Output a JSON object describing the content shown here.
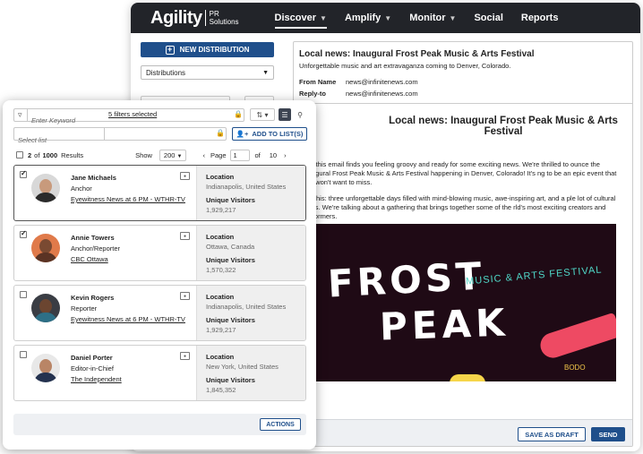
{
  "app": {
    "logo": "Agility",
    "logo_sub_line1": "PR",
    "logo_sub_line2": "Solutions"
  },
  "nav": [
    {
      "label": "Discover",
      "active": true,
      "dropdown": true
    },
    {
      "label": "Amplify",
      "active": false,
      "dropdown": true
    },
    {
      "label": "Monitor",
      "active": false,
      "dropdown": true
    },
    {
      "label": "Social",
      "active": false,
      "dropdown": false
    },
    {
      "label": "Reports",
      "active": false,
      "dropdown": false
    }
  ],
  "left": {
    "new_distribution": "NEW DISTRIBUTION",
    "distributions_select": "Distributions"
  },
  "email": {
    "subject": "Local news: Inaugural Frost Peak Music & Arts Festival",
    "preview": "Unforgettable music and art extravaganza coming to Denver, Colorado.",
    "from_label": "From Name",
    "from_value": "news@infinitenews.com",
    "reply_label": "Reply-to",
    "reply_value": "news@infinitenews.com",
    "title": "Local news: Inaugural Frost Peak Music & Arts Festival",
    "greeting": "llo,",
    "para1": "ope this email finds you feeling groovy and ready for some exciting news. We're thrilled to ounce the inaugural Frost Peak Music & Arts Festival happening in Denver, Colorado! It's ng to be an epic event that you won't want to miss.",
    "para2": "ure this: three unforgettable days filled with mind-blowing music, awe-inspiring art, and a ple lot of cultural vibes. We're talking about a gathering that brings together some of the rld's most exciting creators and performers.",
    "poster_frost": "FROST",
    "poster_peak": "PEAK",
    "poster_tagline": "MUSIC & ARTS FESTIVAL",
    "poster_small": "BODO",
    "save_draft": "SAVE AS DRAFT",
    "send": "SEND"
  },
  "list_panel": {
    "keyword_placeholder": "Enter Keyword",
    "filters_link": "5 filters selected",
    "select_list_placeholder": "Select list",
    "add_to_list": "ADD TO LIST(S)",
    "selected_count": "2",
    "of_label": "of",
    "total": "1000",
    "results_label": "Results",
    "show_label": "Show",
    "show_value": "200",
    "page_label": "Page",
    "page_value": "1",
    "page_of": "of",
    "page_total": "10",
    "actions": "ACTIONS"
  },
  "contacts": [
    {
      "name": "Jane Michaels",
      "title": "Anchor",
      "outlet": "Eyewitness News at 6 PM - WTHR-TV",
      "location_label": "Location",
      "location": "Indianapolis, United States",
      "visitors_label": "Unique Visitors",
      "visitors": "1,929,217",
      "checked": true
    },
    {
      "name": "Annie Towers",
      "title": "Anchor/Reporter",
      "outlet": "CBC Ottawa",
      "location_label": "Location",
      "location": "Ottawa, Canada",
      "visitors_label": "Unique Visitors",
      "visitors": "1,570,322",
      "checked": true
    },
    {
      "name": "Kevin Rogers",
      "title": "Reporter",
      "outlet": "Eyewitness News at 6 PM - WTHR-TV",
      "location_label": "Location",
      "location": "Indianapolis, United States",
      "visitors_label": "Unique Visitors",
      "visitors": "1,929,217",
      "checked": false
    },
    {
      "name": "Daniel Porter",
      "title": "Editor-in-Chief",
      "outlet": "The Independent",
      "location_label": "Location",
      "location": "New York, United States",
      "visitors_label": "Unique Visitors",
      "visitors": "1,845,352",
      "checked": false
    }
  ],
  "colors": {
    "brand_blue": "#1f4f8b",
    "nav_dark": "#222429",
    "poster_bg": "#1f0a15",
    "poster_accent": "#4fd6c7"
  }
}
